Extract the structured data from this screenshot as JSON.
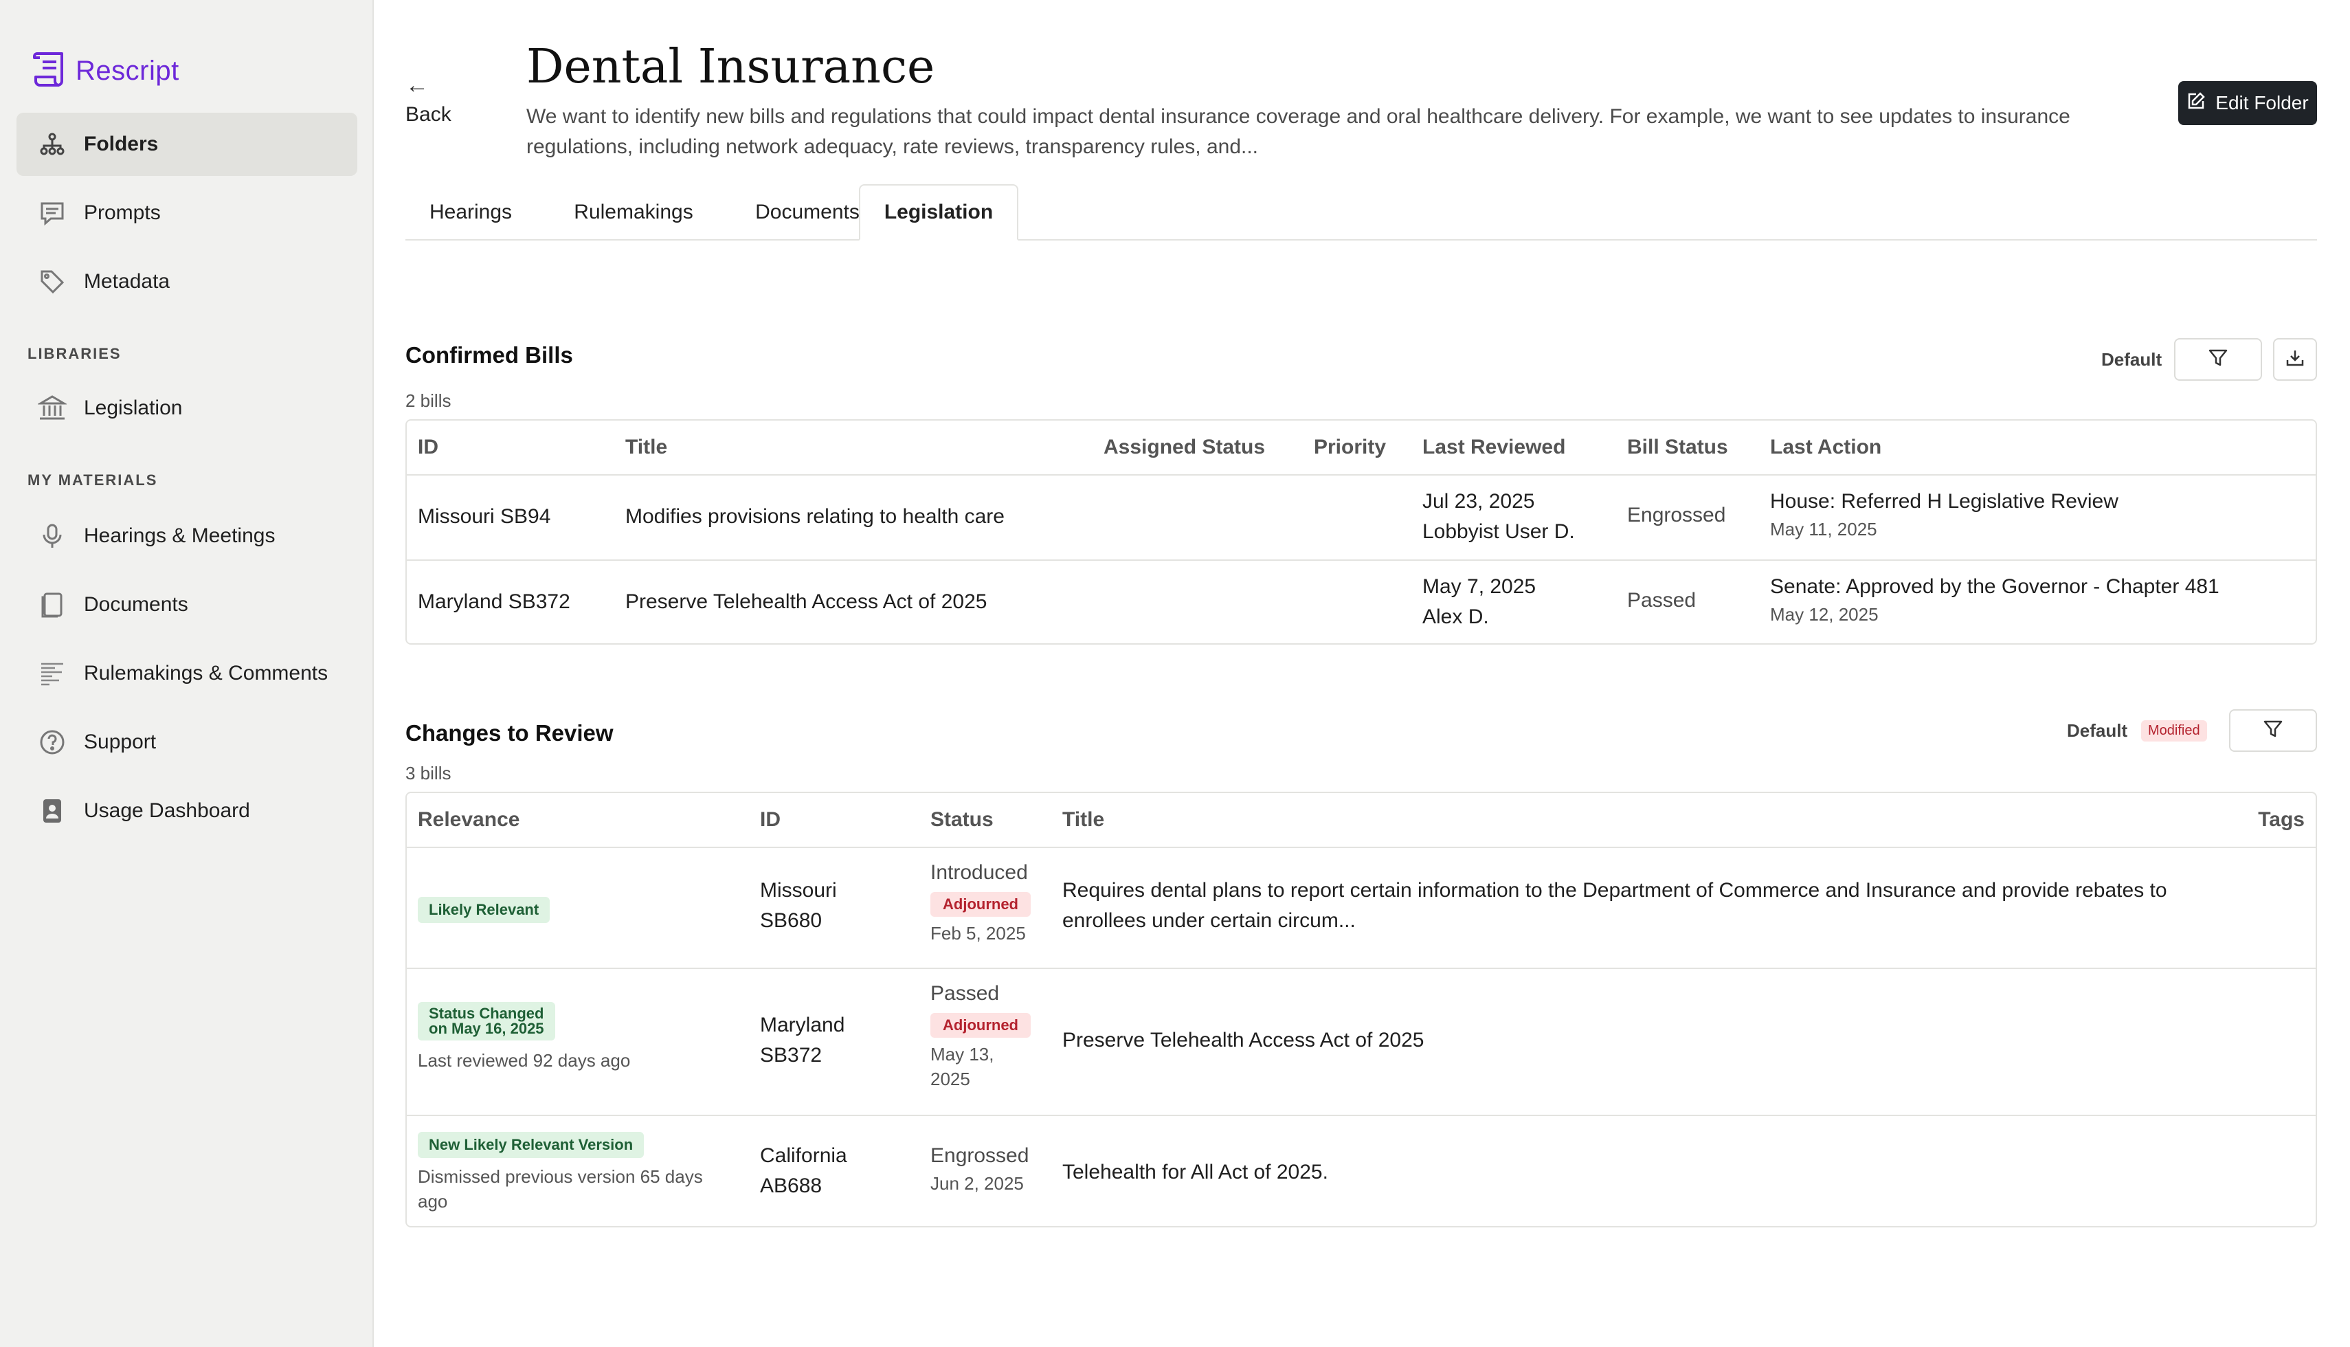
{
  "app": {
    "name": "Rescript",
    "brand_color": "#6d28d9"
  },
  "sidebar": {
    "items": [
      {
        "label": "Folders",
        "icon": "folders-icon",
        "active": true
      },
      {
        "label": "Prompts",
        "icon": "chat-icon"
      },
      {
        "label": "Metadata",
        "icon": "tag-icon"
      }
    ],
    "libraries_label": "LIBRARIES",
    "libraries": [
      {
        "label": "Legislation",
        "icon": "capitol-icon"
      }
    ],
    "materials_label": "MY MATERIALS",
    "materials": [
      {
        "label": "Hearings & Meetings",
        "icon": "microphone-icon"
      },
      {
        "label": "Documents",
        "icon": "document-icon"
      },
      {
        "label": "Rulemakings & Comments",
        "icon": "rulemaking-icon"
      },
      {
        "label": "Support",
        "icon": "help-icon"
      },
      {
        "label": "Usage Dashboard",
        "icon": "dashboard-icon"
      }
    ]
  },
  "header": {
    "back_label": "Back",
    "title": "Dental Insurance",
    "description": "We want to identify new bills and regulations that could impact dental insurance coverage and oral healthcare delivery. For example, we want to see updates to insurance regulations, including network adequacy, rate reviews, transparency rules, and...",
    "edit_label": "Edit Folder"
  },
  "tabs": [
    {
      "label": "Hearings"
    },
    {
      "label": "Rulemakings"
    },
    {
      "label": "Documents"
    },
    {
      "label": "Legislation",
      "active": true
    }
  ],
  "confirmed": {
    "title": "Confirmed Bills",
    "count": "2 bills",
    "view": "Default",
    "columns": [
      "ID",
      "Title",
      "Assigned Status",
      "Priority",
      "Last Reviewed",
      "Bill Status",
      "Last Action"
    ],
    "rows": [
      {
        "id": "Missouri SB94",
        "title": "Modifies provisions relating to health care",
        "assigned_status": "",
        "priority": "",
        "reviewed_date": "Jul 23, 2025",
        "reviewed_by": "Lobbyist User D.",
        "bill_status": "Engrossed",
        "last_action": "House: Referred H Legislative Review",
        "last_action_date": "May 11, 2025"
      },
      {
        "id": "Maryland SB372",
        "title": "Preserve Telehealth Access Act of 2025",
        "assigned_status": "",
        "priority": "",
        "reviewed_date": "May 7, 2025",
        "reviewed_by": "Alex D.",
        "bill_status": "Passed",
        "last_action": "Senate: Approved by the Governor - Chapter 481",
        "last_action_date": "May 12, 2025"
      }
    ]
  },
  "changes": {
    "title": "Changes to Review",
    "count": "3 bills",
    "view": "Default",
    "modified_label": "Modified",
    "columns": [
      "Relevance",
      "ID",
      "Status",
      "Title",
      "Tags"
    ],
    "rows": [
      {
        "relevance": "Likely Relevant",
        "relevance_note": "",
        "id_line1": "Missouri",
        "id_line2": "SB680",
        "status": "Introduced",
        "status_badge": "Adjourned",
        "date": "Feb 5, 2025",
        "title": "Requires dental plans to report certain information to the Department of Commerce and Insurance and provide rebates to enrollees under certain circum..."
      },
      {
        "relevance_line1": "Status Changed",
        "relevance_line2": "on May 16, 2025",
        "relevance_note": "Last reviewed 92 days ago",
        "id_line1": "Maryland",
        "id_line2": "SB372",
        "status": "Passed",
        "status_badge": "Adjourned",
        "date_line1": "May 13,",
        "date_line2": "2025",
        "title": "Preserve Telehealth Access Act of 2025"
      },
      {
        "relevance": "New Likely Relevant Version",
        "relevance_note_line1": "Dismissed previous version 65 days",
        "relevance_note_line2": "ago",
        "id_line1": "California",
        "id_line2": "AB688",
        "status": "Engrossed",
        "date": "Jun 2, 2025",
        "title": "Telehealth for All Act of 2025."
      }
    ]
  }
}
